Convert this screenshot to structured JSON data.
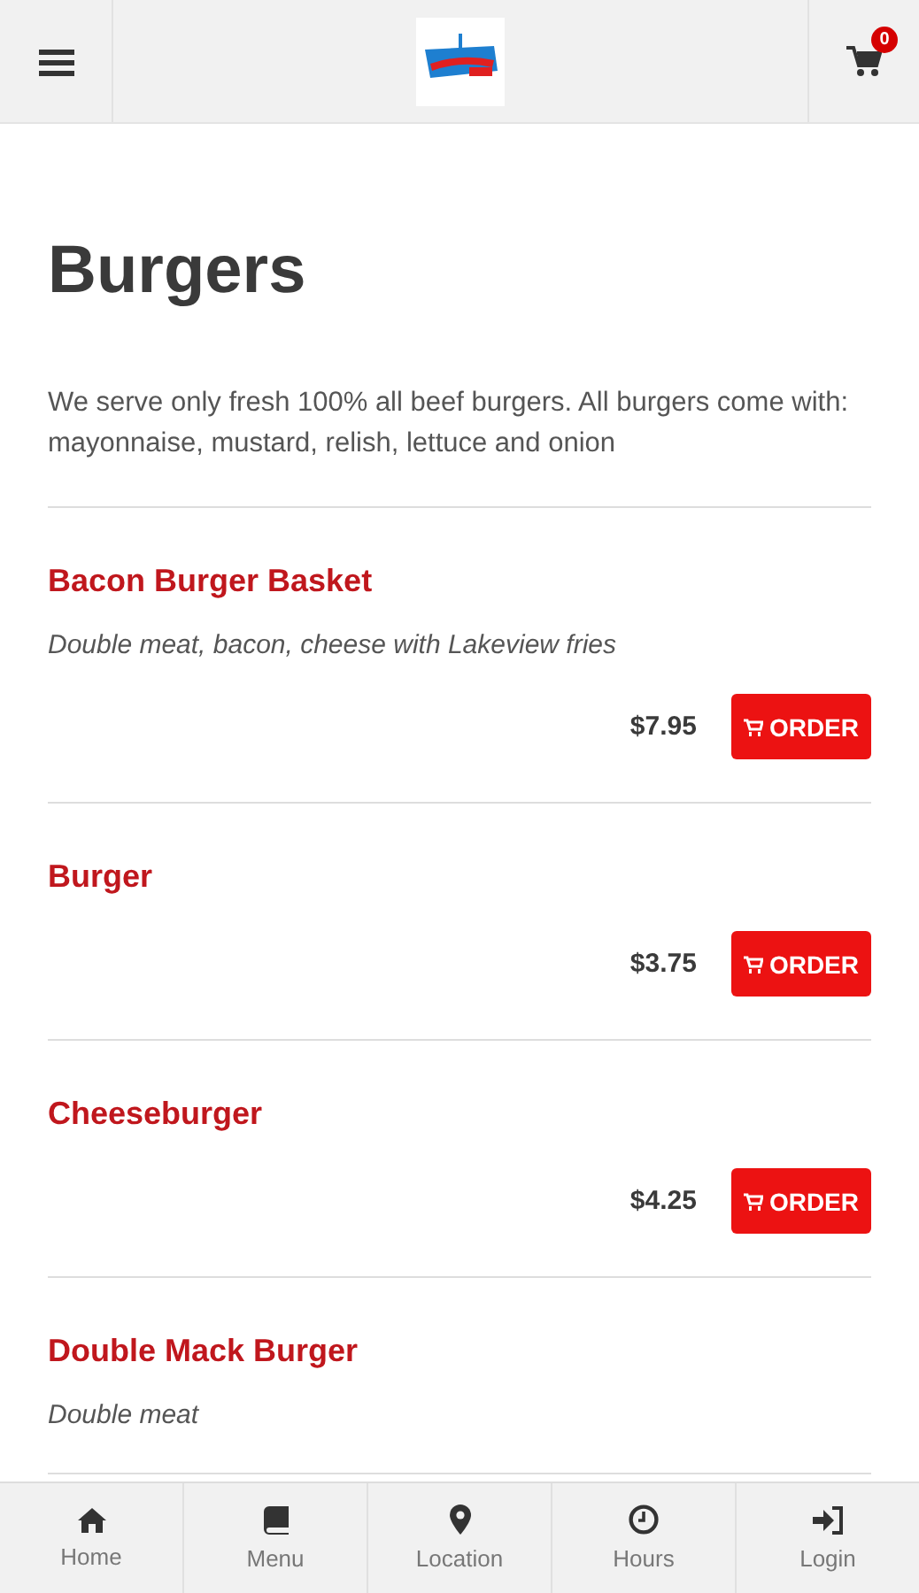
{
  "header": {
    "cart_count": "0"
  },
  "page": {
    "title": "Burgers",
    "description": "We serve only fresh 100% all beef burgers. All burgers come with: mayonnaise, mustard, relish, lettuce and onion"
  },
  "items": [
    {
      "name": "Bacon Burger Basket",
      "description": "Double meat, bacon, cheese with Lakeview fries",
      "price": "$7.95",
      "order_label": "ORDER"
    },
    {
      "name": "Burger",
      "price": "$3.75",
      "order_label": "ORDER"
    },
    {
      "name": "Cheeseburger",
      "price": "$4.25",
      "order_label": "ORDER"
    },
    {
      "name": "Double Mack Burger",
      "description": "Double meat"
    }
  ],
  "bottom_nav": [
    {
      "kind": "home",
      "label": "Home"
    },
    {
      "kind": "menu",
      "label": "Menu"
    },
    {
      "kind": "location",
      "label": "Location"
    },
    {
      "kind": "hours",
      "label": "Hours"
    },
    {
      "kind": "login",
      "label": "Login"
    }
  ]
}
